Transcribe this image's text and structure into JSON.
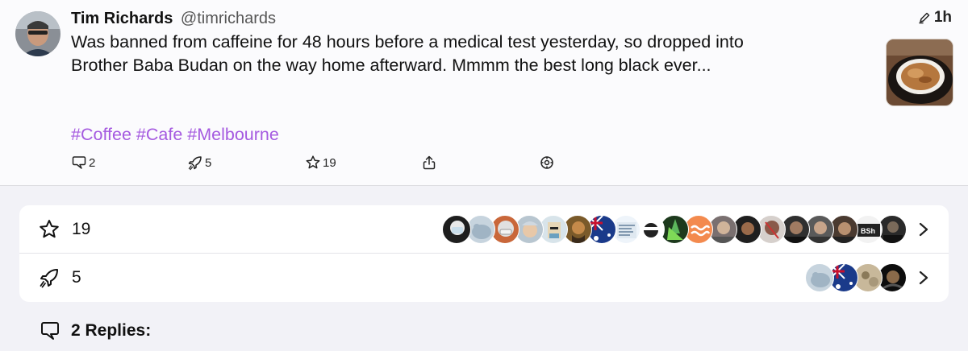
{
  "post": {
    "author_name": "Tim Richards",
    "author_handle": "@timrichards",
    "time_ago": "1h",
    "text": "Was banned from caffeine for 48 hours before a medical test yesterday, so dropped into Brother Baba Budan on the way home afterward. Mmmm the best long black ever...",
    "hashtags": [
      "#Coffee",
      "#Cafe",
      "#Melbourne"
    ],
    "actions": {
      "replies": "2",
      "boosts": "5",
      "favourites": "19"
    }
  },
  "stats": {
    "favourites_count": "19",
    "boosts_count": "5"
  },
  "replies_label": "2 Replies:",
  "icons": {
    "reply": "reply-icon",
    "boost": "boost-icon",
    "favourite": "star-icon",
    "share": "share-icon",
    "more": "more-icon",
    "edited": "pencil-icon",
    "chevron": "chevron-right-icon"
  },
  "colors": {
    "hashtag": "#a55ae0",
    "background": "#f2f2f7",
    "card": "#ffffff"
  }
}
